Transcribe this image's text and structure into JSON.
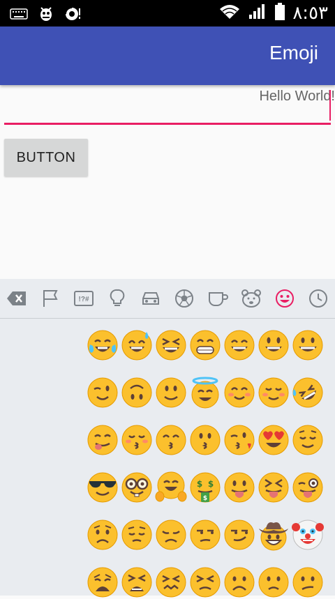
{
  "status_bar": {
    "time": "٨:٥٣",
    "icons": [
      "keyboard-icon",
      "bug-icon",
      "sync-icon",
      "wifi-icon",
      "signal-icon",
      "battery-icon"
    ]
  },
  "app_bar": {
    "title": "Emoji",
    "color": "#3f51b5"
  },
  "edit_text": {
    "value": "Hello World!",
    "accent": "#e91e63"
  },
  "button": {
    "label": "BUTTON"
  },
  "keyboard": {
    "tabs": [
      "backspace-icon",
      "flag-icon",
      "symbols-icon",
      "lightbulb-icon",
      "car-icon",
      "soccer-ball-icon",
      "cup-icon",
      "bear-icon",
      "smiley-icon",
      "clock-icon"
    ],
    "tab_symbols_label": "!?#",
    "active_tab": "smiley-icon",
    "emoji_rows": [
      [
        "😂",
        "😅",
        "😆",
        "😁",
        "😄",
        "😃",
        "😀"
      ],
      [
        "😉",
        "🙃",
        "🙂",
        "😇",
        "😊",
        "☺️",
        "🤣"
      ],
      [
        "😋",
        "😚",
        "😙",
        "😗",
        "😘",
        "😍",
        "😌"
      ],
      [
        "😎",
        "🤓",
        "🤗",
        "🤑",
        "😛",
        "😝",
        "😜"
      ],
      [
        "😟",
        "😔",
        "😞",
        "😒",
        "😏",
        "🤠",
        "🤡"
      ],
      [
        "😩",
        "😫",
        "😖",
        "😣",
        "☹️",
        "🙁",
        "😕"
      ]
    ]
  }
}
